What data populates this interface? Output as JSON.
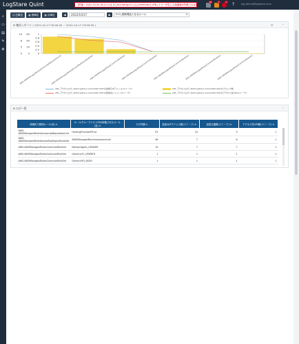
{
  "app": {
    "title": "LogStare Quint"
  },
  "topbar": {
    "alert": "【外部 : 2022-10-20 16:11:11】[C] the-fortigr-01 [1] [FortiGuard_VPN] エラーが生じた為接続が失敗されました",
    "badges": [
      "99",
      "2",
      "1"
    ],
    "help_icon": "question-icon",
    "user": "log-demo@logstare.com"
  },
  "toolbar": {
    "segments": [
      {
        "icon": "clock-icon",
        "label": "日単位"
      },
      {
        "icon": "calendar-icon",
        "label": "週単位"
      },
      {
        "icon": "calendar-icon",
        "label": "月単位"
      }
    ],
    "prev": "◀",
    "next": "▶",
    "date": "2022/10/17",
    "filter": "013_遮断理由となるルール"
  },
  "report_panel": {
    "title": "集計レポート ( 2022-10-17 00:00:00 ~ 2022-10-17 23:59:59 )"
  },
  "chart_data": {
    "type": "bar",
    "categories": [
      "AWS-AWSManagedRulesAmazonIpReputationList",
      "AWS-AWSManagedRulesKnownBadInputsRuleSet",
      "AWS-AWSManagedRulesCommonRuleSet",
      "AWS-AWSManagedRulesCommonRuleSet",
      "AWS-AWSManagedRulesCommonRuleSet",
      "AWS-AWSManagedRulesCommonRuleSet",
      "AWS-AWSManagedRulesCommonRuleSet"
    ],
    "y_ticks_left": [
      "10",
      "8",
      "5",
      "0"
    ],
    "y_ticks_left2": [
      "60",
      "40",
      "20",
      "0"
    ],
    "y_ticks_right": [
      "1",
      "0.8",
      "0.6",
      "0.4",
      "0.2",
      "0"
    ],
    "series": [
      {
        "name": "LBS_アクセスログ_WAFLogStare Quint/AWS WAFのブロック数",
        "values": [
          53,
          46,
          14,
          1,
          1,
          1,
          1
        ],
        "color": "#f2d541"
      },
      {
        "name": "LBS_アクセスログ_WAFLogStare Quint/AWS WAFの送信元IPアドレス(ユニーク)",
        "values": [
          10,
          9,
          7,
          1,
          1,
          1,
          1
        ],
        "color": "#8bb8d9"
      },
      {
        "name": "LBS_アクセスログ_WAFLogStare Quint/AWS WAFの送信先ドメイン(ユニーク)",
        "values": [
          9,
          7,
          6,
          1,
          1,
          1,
          1
        ],
        "color": "#e87070"
      },
      {
        "name": "LBS_アクセスログ_WAFLogStare Quint/AWS WAFのアクセス先URI(ユニーク)",
        "values": [
          1,
          1,
          1,
          1,
          1,
          1,
          1
        ],
        "color": "#6fbf73"
      }
    ]
  },
  "log_panel": {
    "title": "ログ一覧",
    "columns": [
      "評価先で検知ルール(名)",
      "ルールグループリスト内の評価されたルール(名)",
      "ログ件数",
      "送信元IPアドレス数(ユニーク)",
      "送信元国数(ユニーク)",
      "アクセス先URI数(ユニーク)"
    ],
    "rows": [
      [
        "AWS-AWSManagedRulesAmazonIpReputationList",
        "HostingProviderIPList",
        "53",
        "10",
        "9",
        "1"
      ],
      [
        "AWS-AWSManagedRulesKnownBadInputsRuleSet",
        "AWSManagedReconnaissanceList",
        "46",
        "7",
        "6",
        "1"
      ],
      [
        "AWS-AWSManagedRulesCommonRuleSet",
        "NoUserAgent_HEADER",
        "14",
        "7",
        "7",
        "1"
      ],
      [
        "AWS-AWSManagedRulesCommonRuleSet",
        "GenericLFI_URIPATH",
        "1",
        "1",
        "1",
        "1"
      ],
      [
        "AWS-AWSManagedRulesCommonRuleSet",
        "GenericRFI_BODY",
        "1",
        "1",
        "1",
        "1"
      ]
    ]
  }
}
